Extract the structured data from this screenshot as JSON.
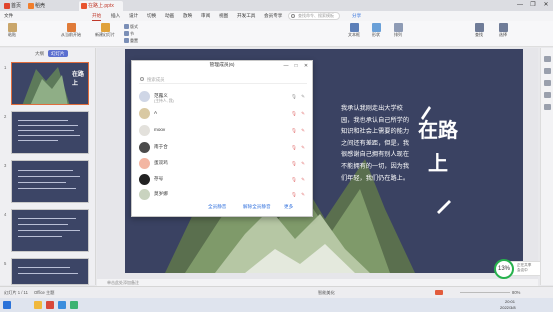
{
  "titlebar": {
    "tabs": [
      {
        "label": "首页",
        "color": "#e0442c"
      },
      {
        "label": "稻壳",
        "color": "#f17e2b"
      },
      {
        "label": "在路上.pptx",
        "color": "#e8542f",
        "active": true
      }
    ],
    "window_buttons": [
      "—",
      "❐",
      "✕"
    ]
  },
  "menubar": {
    "items": [
      "文件",
      "开始",
      "插入",
      "设计",
      "切换",
      "动画",
      "放映",
      "审阅",
      "视图",
      "开发工具",
      "会员专享"
    ],
    "active": "开始",
    "search_placeholder": "查找命令、搜索模板",
    "share_label": "分享"
  },
  "ribbon": {
    "buttons": [
      "粘贴",
      "从当前开始",
      "新建幻灯片",
      "版式",
      "节",
      "重置",
      "文本框",
      "形状",
      "排列",
      "查找",
      "选择"
    ]
  },
  "leftpane": {
    "tabs": [
      "大纲",
      "幻灯片"
    ],
    "active_tab": "幻灯片",
    "thumbnails": [
      {
        "num": "1",
        "title": "在路上"
      },
      {
        "num": "2",
        "title": ""
      },
      {
        "num": "3",
        "title": ""
      },
      {
        "num": "4",
        "title": ""
      },
      {
        "num": "5",
        "title": ""
      }
    ]
  },
  "dialog": {
    "title": "管理成员(6)",
    "search_placeholder": "搜索成员",
    "participants": [
      {
        "name": "范露义",
        "sub": "(主持人, 我)",
        "avatar_color": "#cfd6e6"
      },
      {
        "name": "A",
        "sub": "",
        "avatar_color": "#d9c9a3"
      },
      {
        "name": "moov",
        "sub": "",
        "avatar_color": "#e3e1dc"
      },
      {
        "name": "南于合",
        "sub": "",
        "avatar_color": "#4b4b4b"
      },
      {
        "name": "蛋双鸡",
        "sub": "",
        "avatar_color": "#f3b6a2"
      },
      {
        "name": "存号",
        "sub": "",
        "avatar_color": "#222222"
      },
      {
        "name": "莫岁娜",
        "sub": "",
        "avatar_color": "#c9d3bf"
      }
    ],
    "actions": [
      "全员静音",
      "解除全员静音",
      "更多"
    ]
  },
  "slide": {
    "body_text": "我承认我刚走出大学校园，我也承认自己所学的知识和社会上需要的能力之间还有差距，但是，我很感谢自己拥有别人现在不能拥有的一切，因为我们年轻，我们仍在路上。",
    "title": "在路上"
  },
  "notes": {
    "placeholder": "单击此处添加备注"
  },
  "statusbar": {
    "slide_info": "幻灯片 1 / 11",
    "theme": "Office 主题",
    "notes_label": "智能美化",
    "zoom": "80%"
  },
  "recorder": {
    "percent": "13%",
    "line1": "正在共享",
    "line2": "会议中"
  },
  "taskbar": {
    "time": "20:01",
    "date": "2022/3/8"
  },
  "colors": {
    "accent": "#c0392b",
    "slide_bg": "#3a4262",
    "link": "#2f6fdd",
    "recorder_ring": "#27b24d"
  }
}
